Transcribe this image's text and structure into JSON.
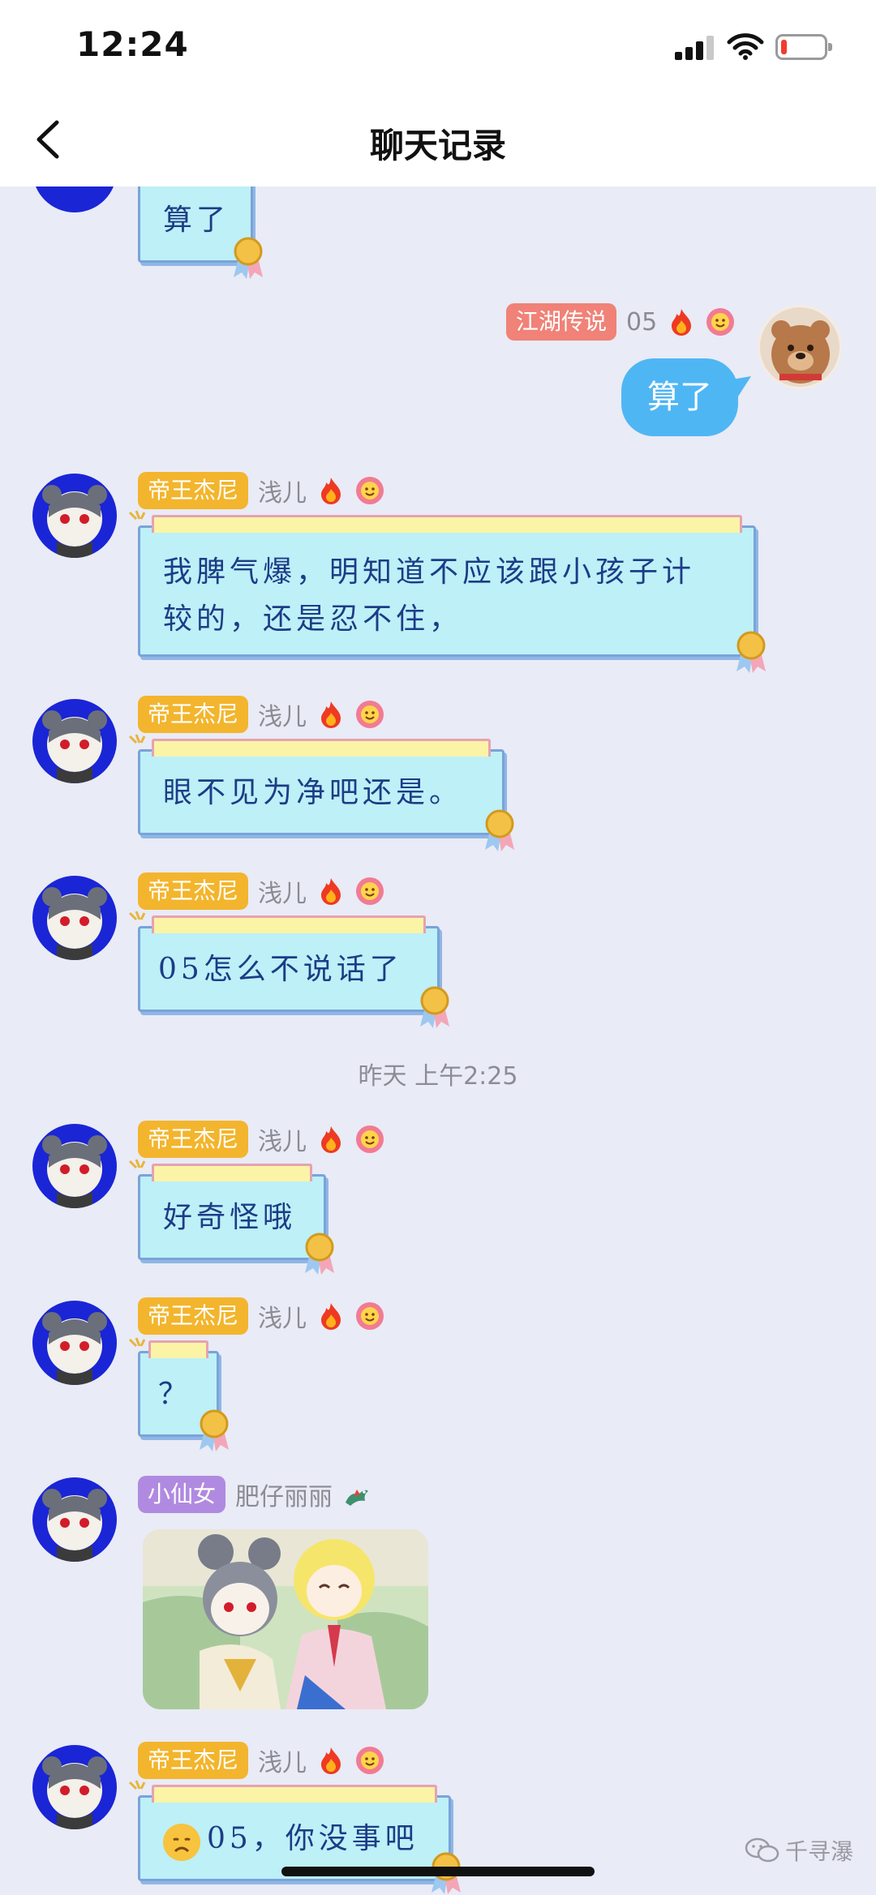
{
  "status_bar": {
    "time": "12:24"
  },
  "header": {
    "title": "聊天记录"
  },
  "messages": [
    {
      "tag": "江湖传说",
      "nick": "05",
      "text": "算了"
    },
    {
      "tag": "帝王杰尼",
      "nick": "浅儿",
      "text_line1": "我脾气爆，明知道不应该跟小孩子计",
      "text_line2": "较的，还是忍不住，"
    },
    {
      "tag": "帝王杰尼",
      "nick": "浅儿",
      "text": "眼不见为净吧还是。"
    },
    {
      "tag": "帝王杰尼",
      "nick": "浅儿",
      "text": "05怎么不说话了"
    },
    {
      "tag": "帝王杰尼",
      "nick": "浅儿",
      "text": "好奇怪哦"
    },
    {
      "tag": "帝王杰尼",
      "nick": "浅儿",
      "text": "？"
    },
    {
      "tag": "小仙女",
      "nick": "肥仔丽丽"
    },
    {
      "tag": "帝王杰尼",
      "nick": "浅儿",
      "text": "05，你没事吧"
    }
  ],
  "partial_top_message": {
    "text": "算了"
  },
  "timestamp": "昨天 上午2:25",
  "watermark": "千寻瀑",
  "colors": {
    "background": "#e9ebf6",
    "self_bubble": "#4fb6f4",
    "tag_gold": "#f3b52d",
    "tag_red": "#f08278",
    "tag_purple": "#b08ae0",
    "card_fill": "#bdf0f7",
    "card_text": "#1d3c86"
  },
  "icons": [
    "back-chevron-icon",
    "fire-icon",
    "smiley-flower-icon",
    "dragon-icon",
    "medal-icon",
    "sad-face-emoji-icon",
    "wechat-icon"
  ]
}
